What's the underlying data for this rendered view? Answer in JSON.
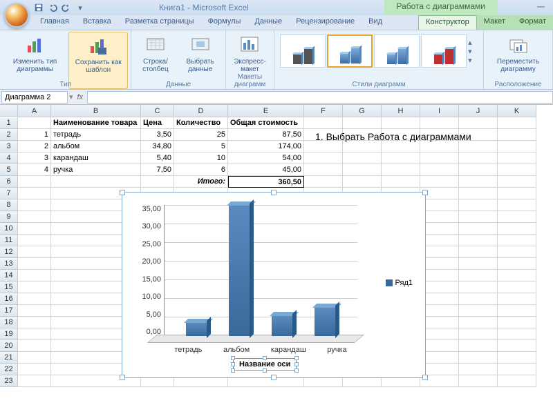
{
  "window": {
    "title": "Книга1 - Microsoft Excel",
    "chart_tools": "Работа с диаграммами"
  },
  "tabs": {
    "home": "Главная",
    "insert": "Вставка",
    "layout": "Разметка страницы",
    "formulas": "Формулы",
    "data": "Данные",
    "review": "Рецензирование",
    "view": "Вид",
    "ctx_design": "Конструктор",
    "ctx_layout": "Макет",
    "ctx_format": "Формат"
  },
  "ribbon": {
    "type_group": "Тип",
    "data_group": "Данные",
    "layouts_group": "Макеты диаграмм",
    "styles_group": "Стили диаграмм",
    "location_group": "Расположение",
    "change_type": "Изменить тип\nдиаграммы",
    "save_template": "Сохранить\nкак шаблон",
    "switch_rc": "Строка/столбец",
    "select_data": "Выбрать\nданные",
    "quick_layout": "Экспресс-макет",
    "move_chart": "Переместить\nдиаграмму"
  },
  "formula_bar": {
    "namebox": "Диаграмма 2",
    "fx": "fx"
  },
  "cols": [
    "A",
    "B",
    "C",
    "D",
    "E",
    "F",
    "G",
    "H",
    "I",
    "J",
    "K"
  ],
  "table": {
    "headers": {
      "b": "Наименование товара",
      "c": "Цена",
      "d": "Количество",
      "e": "Общая стоимость"
    },
    "rows": [
      {
        "n": "1",
        "name": "тетрадь",
        "price": "3,50",
        "qty": "25",
        "total": "87,50"
      },
      {
        "n": "2",
        "name": "альбом",
        "price": "34,80",
        "qty": "5",
        "total": "174,00"
      },
      {
        "n": "3",
        "name": "карандаш",
        "price": "5,40",
        "qty": "10",
        "total": "54,00"
      },
      {
        "n": "4",
        "name": "ручка",
        "price": "7,50",
        "qty": "6",
        "total": "45,00"
      }
    ],
    "total_label": "Итого:",
    "total_value": "360,50"
  },
  "annotation": "1. Выбрать Работа с диаграммами",
  "chart": {
    "legend": "Ряд1",
    "axis_title": "Название оси",
    "yticks": [
      "35,00",
      "30,00",
      "25,00",
      "20,00",
      "15,00",
      "10,00",
      "5,00",
      "0,00"
    ]
  },
  "chart_data": {
    "type": "bar",
    "categories": [
      "тетрадь",
      "альбом",
      "карандаш",
      "ручка"
    ],
    "values": [
      3.5,
      34.8,
      5.4,
      7.5
    ],
    "series_name": "Ряд1",
    "xlabel": "Название оси",
    "ylabel": "",
    "ylim": [
      0,
      35
    ],
    "ystep": 5
  }
}
